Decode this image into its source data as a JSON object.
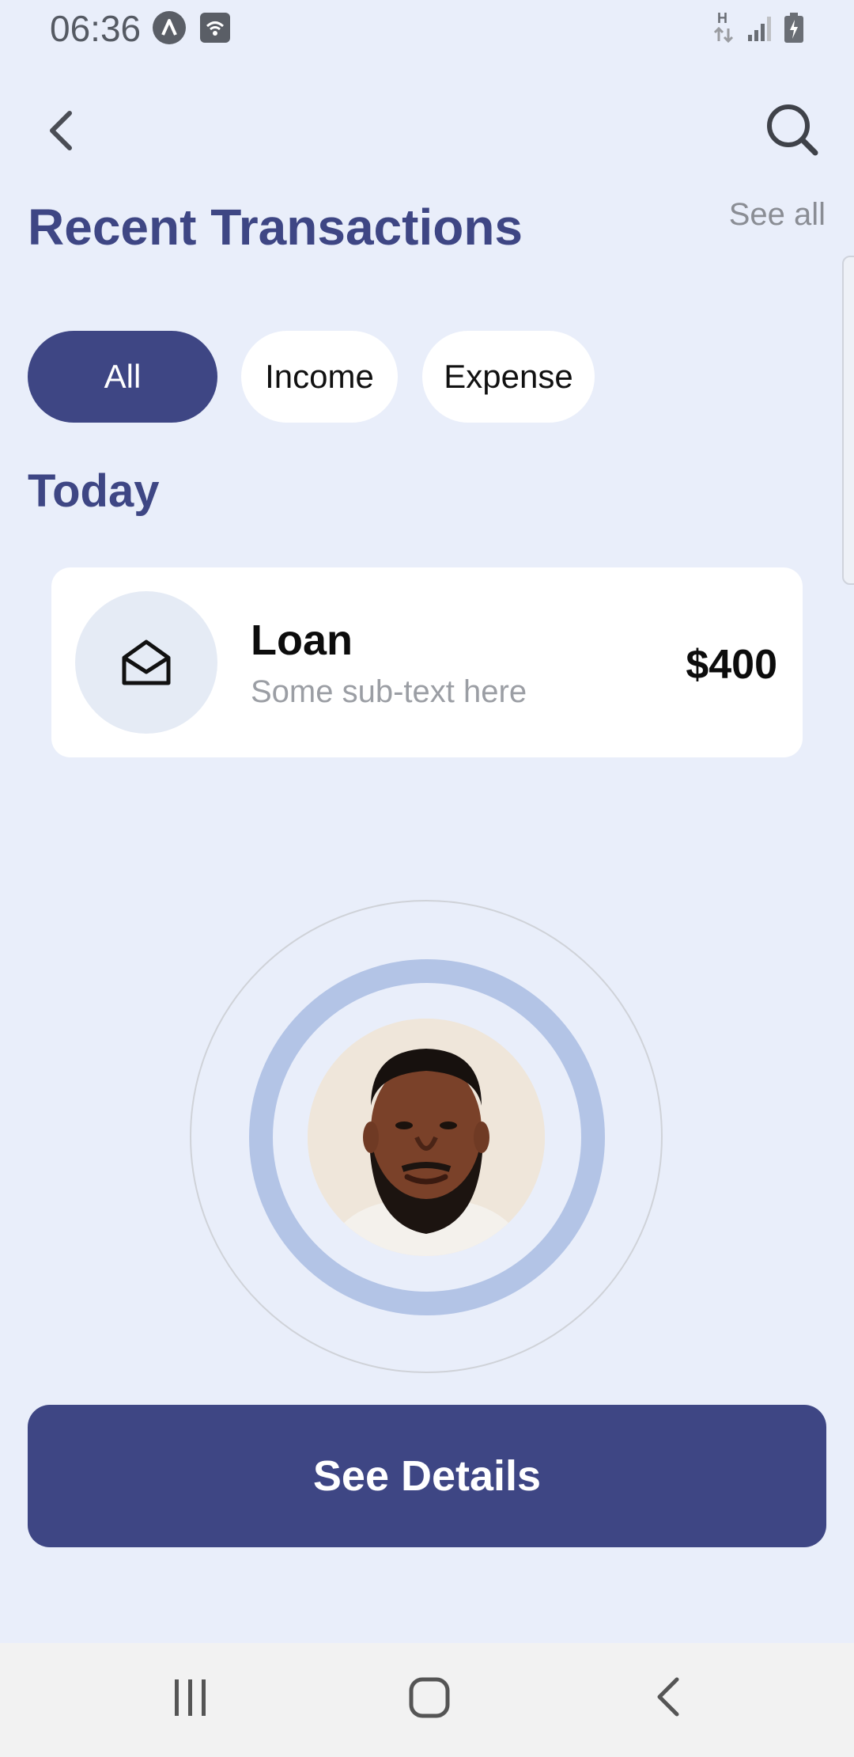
{
  "status_bar": {
    "time": "06:36",
    "network_label": "H"
  },
  "header": {
    "title": "Recent Transactions",
    "see_all": "See all"
  },
  "filters": {
    "items": [
      {
        "label": "All",
        "active": true
      },
      {
        "label": "Income",
        "active": false
      },
      {
        "label": "Expense",
        "active": false
      }
    ]
  },
  "section": {
    "today": "Today"
  },
  "transaction": {
    "icon": "envelope-open-icon",
    "title": "Loan",
    "subtitle": "Some sub-text here",
    "amount": "$400"
  },
  "cta": {
    "label": "See Details"
  },
  "colors": {
    "primary": "#3e4684",
    "background": "#e9eefa",
    "ring": "#b3c4e6"
  }
}
